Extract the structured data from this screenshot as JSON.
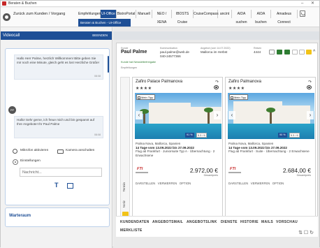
{
  "window": {
    "title": "Beraten & Buchen",
    "minimize": "–",
    "close": "✕"
  },
  "topbar": {
    "back_label": "Zurück zum Kunden / Vorgang",
    "tabs": [
      {
        "label": "Empfehlungen",
        "active": false
      },
      {
        "label": "UI-Office",
        "active": true
      },
      {
        "label": "BistroPortal",
        "active": false
      },
      {
        "label": "Manuell",
        "active": false
      },
      {
        "label": "NEO / XENA",
        "active": false
      },
      {
        "label": "IBOSTS Cruise",
        "active": false
      },
      {
        "label": "CruiseCompass",
        "active": false
      },
      {
        "label": "ancint",
        "active": false
      },
      {
        "label": "AIDA suchen",
        "active": false
      },
      {
        "label": "AIDA buchen",
        "active": false
      },
      {
        "label": "Amadeus Connect",
        "active": false
      }
    ],
    "subtab": "Beraten & Buchen - UI-Office"
  },
  "sidebar": {
    "videocall_title": "Videocall",
    "end_label": "BEENDEN",
    "messages": [
      {
        "text": "Hallo Herr Palme, herzlich Willkommen! Bitte geben Sie mir noch eine Minute, gleich geht es los! Herzliche Grüße!",
        "time": "08:08"
      },
      {
        "text": "Hallo! Sehr gerne, ich freue mich und bin gespannt auf Ihre Angebote! Ihr Paul Palme",
        "time": "08:08"
      }
    ],
    "avatar_initials": "PP",
    "mic_label": "Mikrofon aktivieren",
    "camera_label": "Kamera anschalten",
    "settings_label": "Einstellungen",
    "chat_placeholder": "Nachricht...",
    "waiting_room": "Warteraum"
  },
  "customer": {
    "label_kunde": "Kunde",
    "name": "Paul Palme",
    "label_contact": "Kommunikation",
    "email": "paul.palme@web.de",
    "phone": "040-24577366",
    "label_offer": "Angebot (vom 14.07.2022)",
    "offer_dest": "Mallorca im Herbst",
    "label_reise": "Reisen",
    "reise_no": "4444",
    "newsletter": "Kunde hat Newsletterfreigabe",
    "empfehlungen_label": "Empfehlungen"
  },
  "notiz": {
    "label_notiz": "Notiz",
    "label_termin": "Termin"
  },
  "offers": [
    {
      "name": "Zafiro Palace Palmanova",
      "stars": "★★★★",
      "tag": "Mein Tipp",
      "pct": "91 %",
      "rating": "5.3 / 6",
      "location": "Palma Nova, Mallorca, Spanien",
      "dates": "14 Tage vom 13.09.2022 bis 27.09.2022",
      "flight": "Flug ab Frankfurt · Juniorsuite Typ A · Übernachtung · 2 Erwachsene",
      "operator": "FTI",
      "price": "2.972,00 €",
      "gesamt": "Gesamtpreis",
      "actions": [
        "DARSTELLEN",
        "VERWERFEN",
        "OPTION"
      ]
    },
    {
      "name": "Zafiro Palmanova",
      "stars": "★★★★",
      "tag": "Mein Tipp",
      "pct": "90 %",
      "rating": "5.3 / 6",
      "location": "Palma Nova, Mallorca, Spanien",
      "dates": "14 Tage vom 13.09.2022 bis 27.09.2022",
      "flight": "Flug ab Frankfurt · Suite · Übernachtung · 2 Erwachsene",
      "operator": "FTI",
      "price": "2.684,00 €",
      "gesamt": "Gesamtpreis",
      "actions": [
        "DARSTELLEN",
        "VERWERFEN",
        "OPTION"
      ]
    }
  ],
  "bottom_tabs": [
    "KUNDENDATEN",
    "ANGEBOTSMAIL",
    "ANGEBOTSLINK",
    "DIENSTE",
    "HISTORIE",
    "MAILS",
    "VORSCHAU",
    "MERKLISTE"
  ],
  "colors": {
    "primary": "#1e4f96",
    "accent_red": "#c62828",
    "newsletter_green": "#2e7d32",
    "note_yellow": "#f2c318"
  }
}
